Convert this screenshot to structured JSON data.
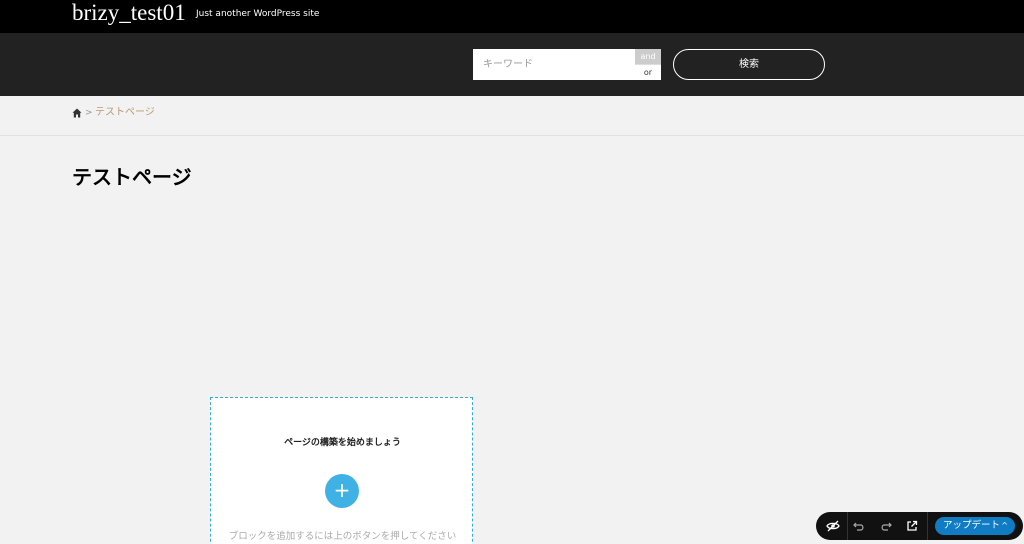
{
  "header": {
    "site_title": "brizy_test01",
    "tagline": "Just another WordPress site"
  },
  "search": {
    "placeholder": "キーワード",
    "and_label": "and",
    "or_label": "or",
    "button_label": "検索"
  },
  "breadcrumb": {
    "separator": ">",
    "current": "テストページ"
  },
  "page": {
    "title": "テストページ"
  },
  "builder": {
    "heading": "ページの構築を始めましょう",
    "add_symbol": "+",
    "hint": "ブロックを追加するには上のボタンを押してください"
  },
  "toolbar": {
    "icons": [
      "preview-hide-icon",
      "undo-icon",
      "redo-icon",
      "external-link-icon"
    ],
    "update_label": "アップデート",
    "update_caret": "^"
  },
  "colors": {
    "topbar": "#000000",
    "searchbar": "#222222",
    "accent": "#3fb1e5",
    "update_button": "#0f7cc4",
    "breadcrumb_current": "#b89a74"
  }
}
